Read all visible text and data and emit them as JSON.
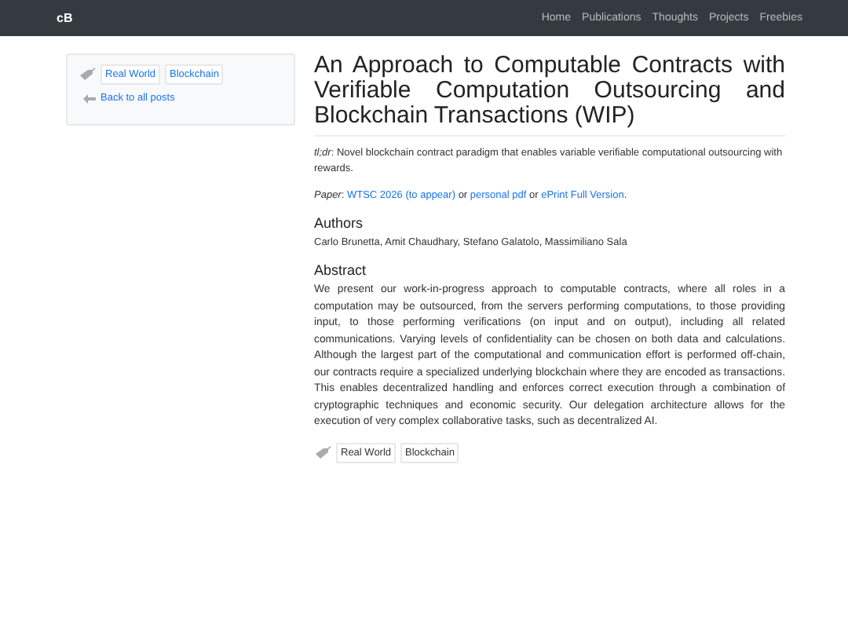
{
  "navbar": {
    "brand": "cB",
    "links": [
      "Home",
      "Publications",
      "Thoughts",
      "Projects",
      "Freebies"
    ]
  },
  "sidebar": {
    "tags": [
      "Real World",
      "Blockchain"
    ],
    "back_link": "Back to all posts"
  },
  "post": {
    "title": "An Approach to Computable Contracts with Verifiable Computation Outsourcing and Blockchain Transactions (WIP)",
    "tldr": "*tl;dr*: Novel blockchain contract paradigm that enables variable verifiable computational outsourcing with rewards.",
    "paper": [
      {
        "kind": "text",
        "text": "*Paper*:"
      },
      {
        "kind": "link",
        "text": "WTSC 2026 (to appear)"
      },
      {
        "kind": "text",
        "text": "or"
      },
      {
        "kind": "link",
        "text": "personal pdf"
      },
      {
        "kind": "text",
        "text": "or"
      },
      {
        "kind": "link",
        "text": "ePrint Full Version"
      },
      {
        "kind": "text",
        "text": "."
      }
    ],
    "authors_heading": "Authors",
    "authors": "Carlo Brunetta, Amit Chaudhary, Stefano Galatolo, Massimiliano Sala",
    "abstract_heading": "Abstract",
    "abstract": "We present our work-in-progress approach to computable contracts, where all roles in a computation may be outsourced, from the servers performing computations, to those providing input, to those performing verifications (on input and on output), including all related communications. Varying levels of confidentiality can be chosen on both data and calculations. Although the largest part of the computational and communication effort is performed off-chain, our contracts require a specialized underlying blockchain where they are encoded as transactions. This enables decentralized handling and enforces correct execution through a combination of cryptographic techniques and economic security. Our delegation architecture allows for the execution of very complex collaborative tasks, such as decentralized AI.",
    "tags": [
      "Real World",
      "Blockchain"
    ]
  }
}
